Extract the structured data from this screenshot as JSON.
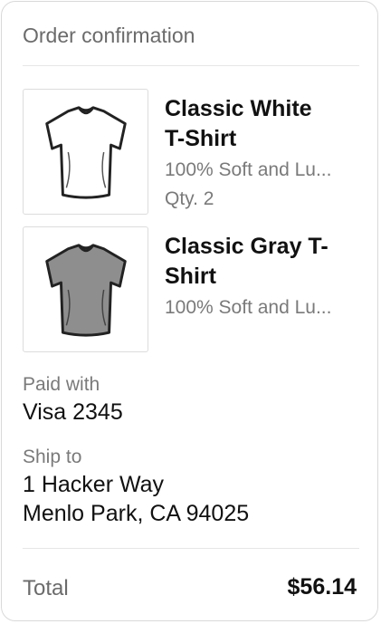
{
  "header": {
    "title": "Order confirmation"
  },
  "items": [
    {
      "name": "Classic White T-Shirt",
      "name_line1": "Classic White",
      "name_line2": "T-Shirt",
      "description": "100% Soft and Lu...",
      "quantity": "Qty. 2",
      "shirt_color": "#ffffff",
      "icon": "white-tshirt-image"
    },
    {
      "name": "Classic Gray T-Shirt",
      "name_line1": "Classic Gray T-",
      "name_line2": "Shirt",
      "description": "100% Soft and Lu...",
      "shirt_color": "#8e8e8e",
      "icon": "gray-tshirt-image"
    }
  ],
  "payment": {
    "label": "Paid with",
    "value": "Visa 2345"
  },
  "shipping": {
    "label": "Ship to",
    "line1": "1 Hacker Way",
    "line2": "Menlo Park, CA 94025"
  },
  "total": {
    "label": "Total",
    "value": "$56.14"
  },
  "colors": {
    "text": "#111111",
    "muted": "#7a7a7a",
    "border": "#dcdcdc"
  }
}
